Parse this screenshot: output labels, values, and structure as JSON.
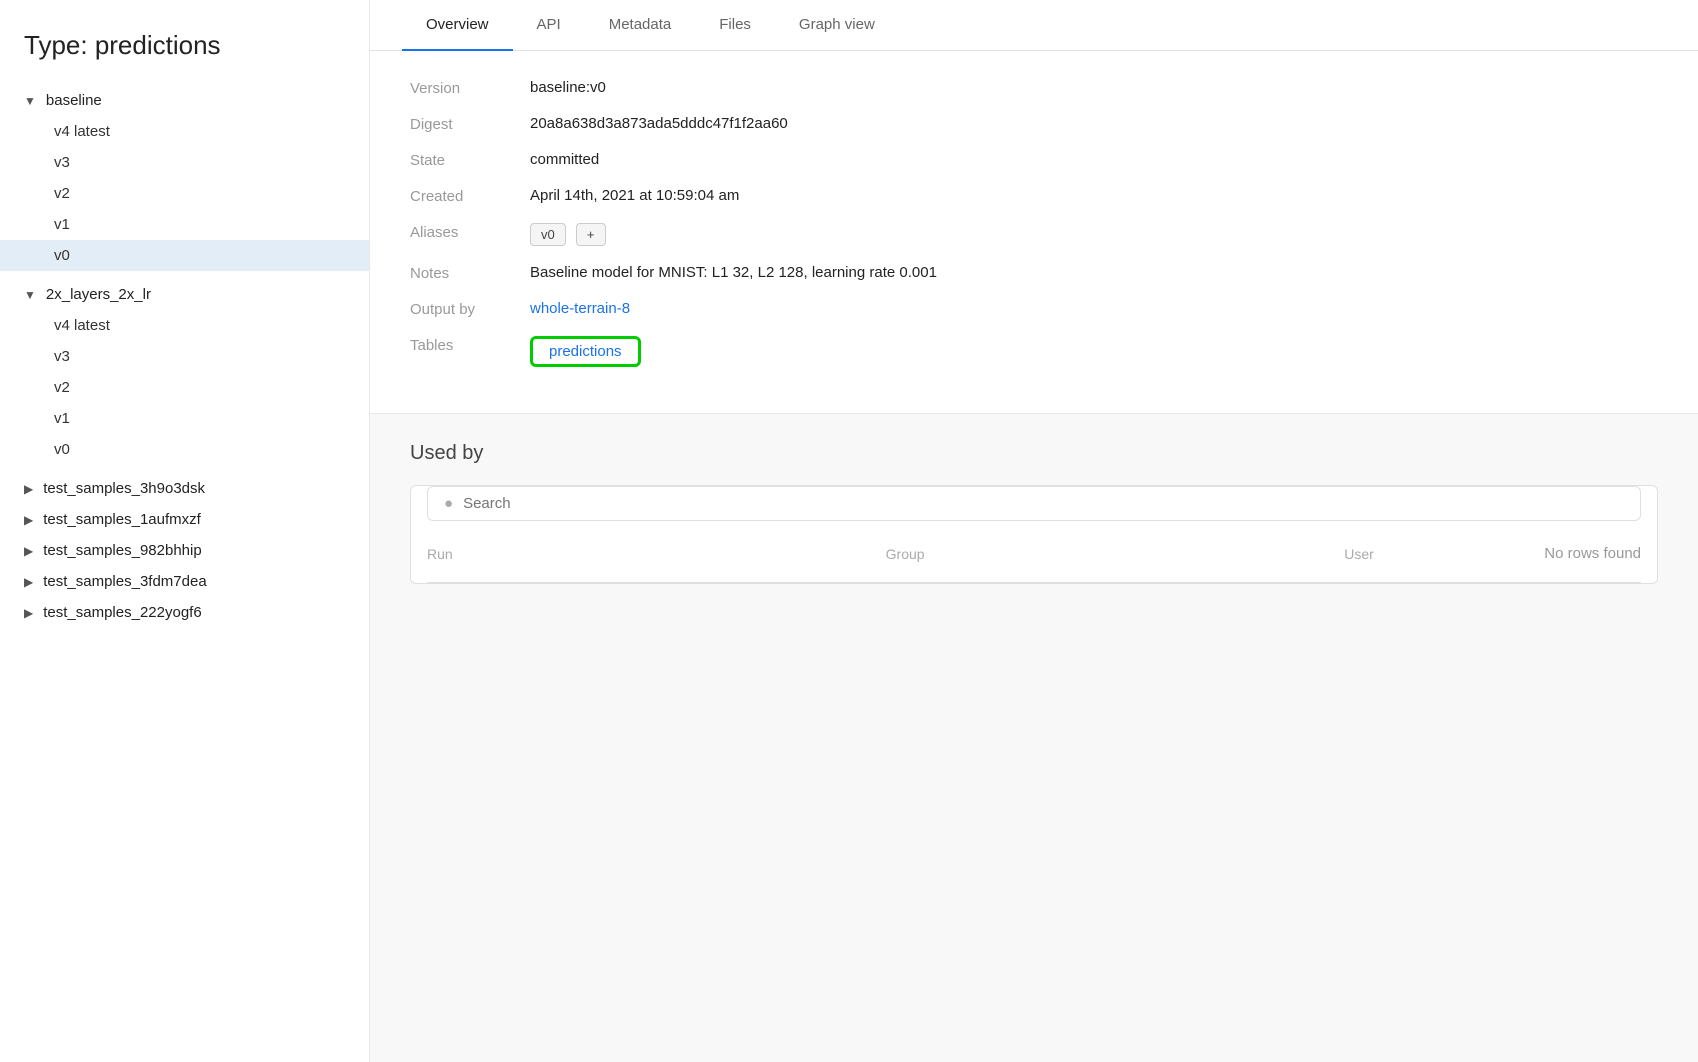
{
  "sidebar": {
    "title": "Type: predictions",
    "groups": [
      {
        "name": "baseline",
        "expanded": true,
        "items": [
          {
            "label": "v4 latest",
            "active": false
          },
          {
            "label": "v3",
            "active": false
          },
          {
            "label": "v2",
            "active": false
          },
          {
            "label": "v1",
            "active": false
          },
          {
            "label": "v0",
            "active": true
          }
        ]
      },
      {
        "name": "2x_layers_2x_lr",
        "expanded": true,
        "items": [
          {
            "label": "v4 latest",
            "active": false
          },
          {
            "label": "v3",
            "active": false
          },
          {
            "label": "v2",
            "active": false
          },
          {
            "label": "v1",
            "active": false
          },
          {
            "label": "v0",
            "active": false
          }
        ]
      }
    ],
    "collapsed_groups": [
      {
        "name": "test_samples_3h9o3dsk"
      },
      {
        "name": "test_samples_1aufmxzf"
      },
      {
        "name": "test_samples_982bhhip"
      },
      {
        "name": "test_samples_3fdm7dea"
      },
      {
        "name": "test_samples_222yogf6"
      }
    ]
  },
  "tabs": [
    {
      "label": "Overview",
      "active": true
    },
    {
      "label": "API",
      "active": false
    },
    {
      "label": "Metadata",
      "active": false
    },
    {
      "label": "Files",
      "active": false
    },
    {
      "label": "Graph view",
      "active": false
    }
  ],
  "overview": {
    "fields": [
      {
        "label": "Version",
        "value": "baseline:v0",
        "type": "text"
      },
      {
        "label": "Digest",
        "value": "20a8a638d3a873ada5dddc47f1f2aa60",
        "type": "text"
      },
      {
        "label": "State",
        "value": "committed",
        "type": "text"
      },
      {
        "label": "Created",
        "value": "April 14th, 2021 at 10:59:04 am",
        "type": "text"
      },
      {
        "label": "Aliases",
        "value": "",
        "type": "aliases"
      },
      {
        "label": "Notes",
        "value": "Baseline model for MNIST: L1 32, L2 128, learning rate 0.001",
        "type": "text"
      },
      {
        "label": "Output by",
        "value": "whole-terrain-8",
        "type": "link"
      },
      {
        "label": "Tables",
        "value": "predictions",
        "type": "table-link"
      }
    ],
    "aliases": {
      "badge": "v0",
      "plus": "+"
    }
  },
  "used_by": {
    "title": "Used by",
    "search_placeholder": "Search",
    "columns": [
      "Run",
      "Group",
      "User"
    ],
    "no_rows_message": "No rows found"
  }
}
